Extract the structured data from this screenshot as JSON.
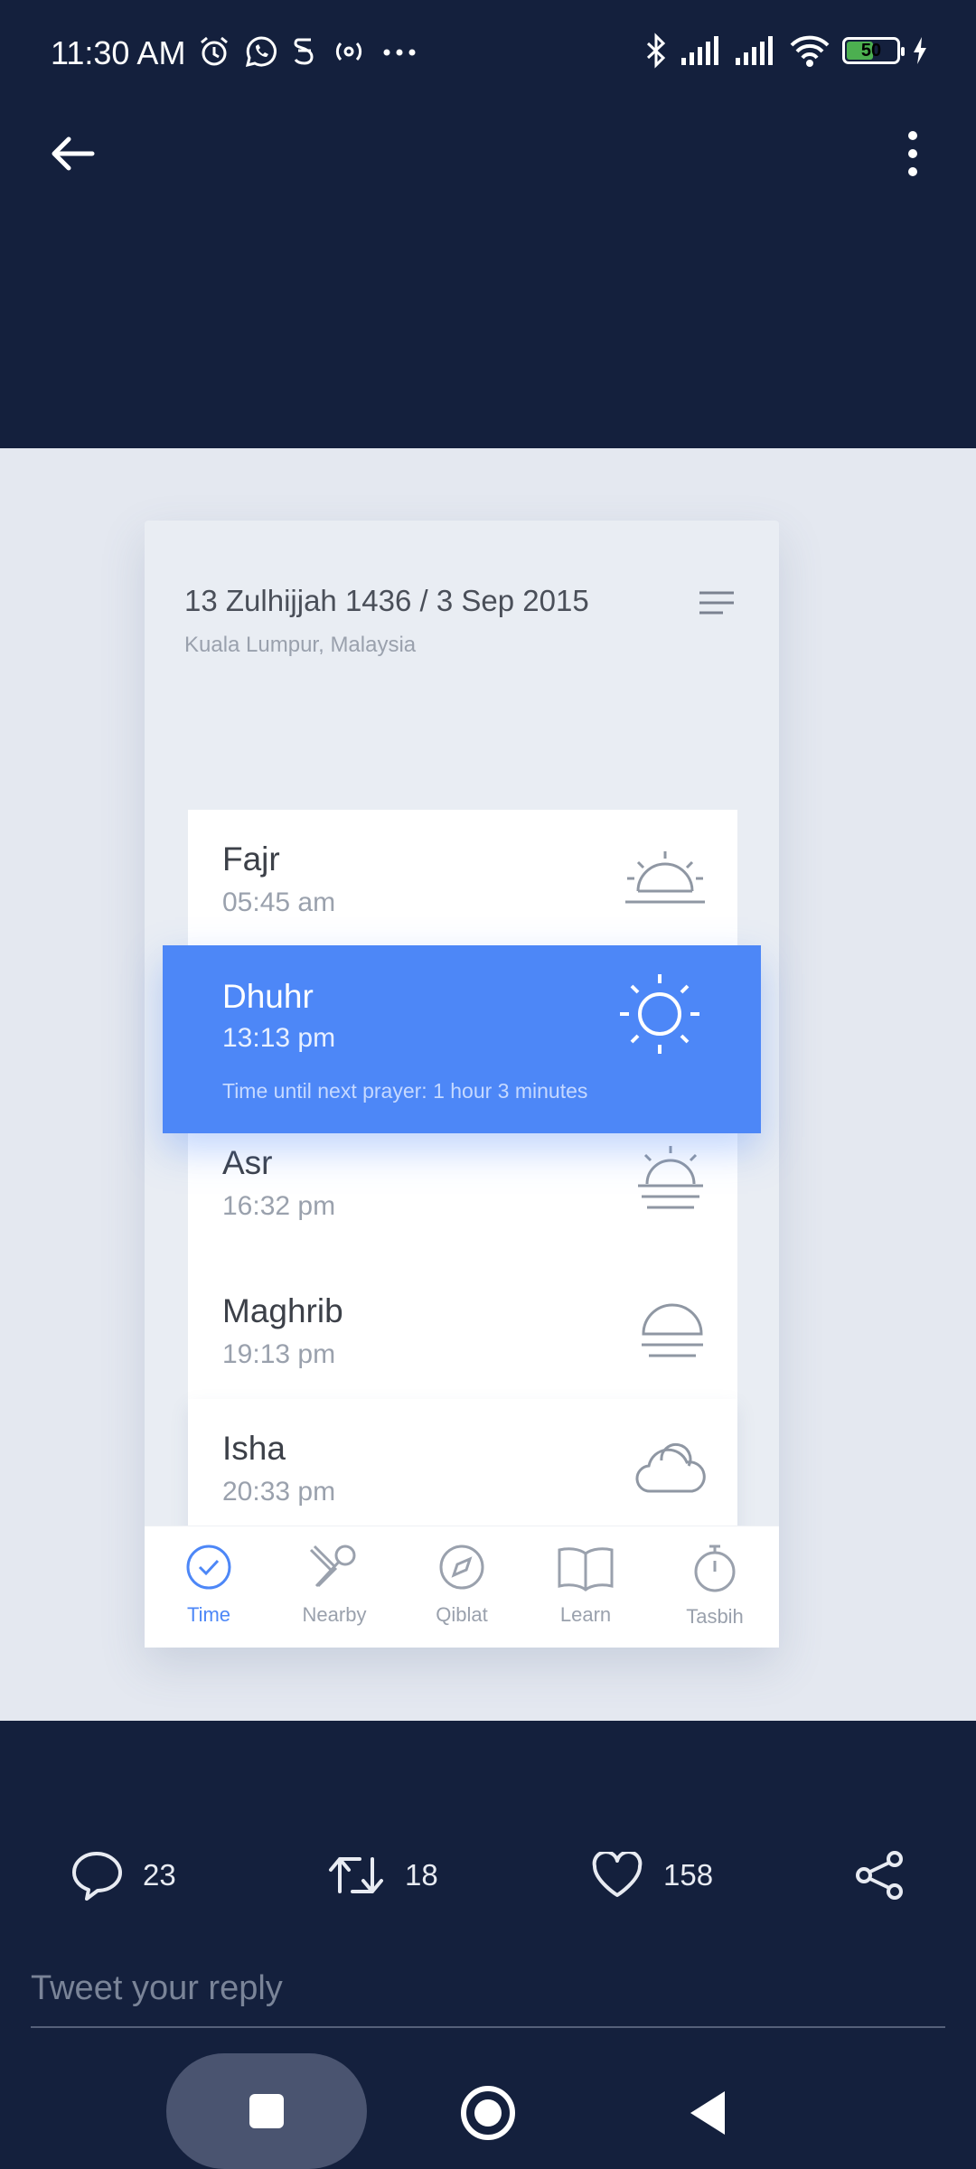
{
  "status_bar": {
    "time": "11:30 AM",
    "battery": "50",
    "left_icons": [
      "alarm-icon",
      "whatsapp-icon",
      "sim-icon",
      "hotspot-icon",
      "more-dots-icon"
    ],
    "right_icons": [
      "bluetooth-icon",
      "signal-icon",
      "signal-icon",
      "wifi-icon",
      "battery-icon",
      "charging-icon"
    ]
  },
  "header": {
    "back_icon": "arrow-left-icon",
    "more_icon": "more-vertical-icon"
  },
  "media": {
    "date": "13 Zulhijjah 1436 / 3 Sep 2015",
    "location": "Kuala Lumpur, Malaysia",
    "prayers": [
      {
        "name": "Fajr",
        "time": "05:45 am",
        "icon": "sunrise-icon"
      },
      {
        "name": "Dhuhr",
        "time": "13:13 pm",
        "icon": "sun-icon",
        "note": "Time until next prayer: 1 hour 3 minutes"
      },
      {
        "name": "Asr",
        "time": "16:32 pm",
        "icon": "sun-horizon-icon"
      },
      {
        "name": "Maghrib",
        "time": "19:13 pm",
        "icon": "sunset-icon"
      },
      {
        "name": "Isha",
        "time": "20:33 pm",
        "icon": "cloud-icon"
      }
    ],
    "tabs": [
      {
        "label": "Time",
        "icon": "clock-check-icon",
        "active": true
      },
      {
        "label": "Nearby",
        "icon": "utensils-icon"
      },
      {
        "label": "Qiblat",
        "icon": "compass-icon"
      },
      {
        "label": "Learn",
        "icon": "book-icon"
      },
      {
        "label": "Tasbih",
        "icon": "stopwatch-icon"
      }
    ]
  },
  "actions": {
    "replies": "23",
    "retweets": "18",
    "likes": "158"
  },
  "reply": {
    "placeholder": "Tweet your reply"
  },
  "colors": {
    "background": "#14203d",
    "accent": "#4d87f7",
    "media_bg": "#e4e8f0"
  }
}
